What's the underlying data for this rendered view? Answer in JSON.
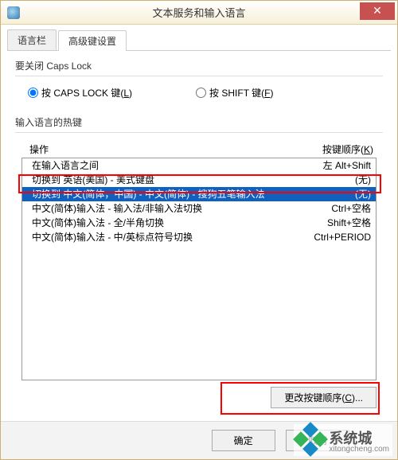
{
  "window": {
    "title": "文本服务和输入语言"
  },
  "tabs": {
    "tab1": "语言栏",
    "tab2": "高级键设置"
  },
  "group1": {
    "label": "要关闭 Caps Lock",
    "radio1_pre": "按 CAPS LOCK 键(",
    "radio1_u": "L",
    "radio1_post": ")",
    "radio2_pre": "按 SHIFT 键(",
    "radio2_u": "F",
    "radio2_post": ")"
  },
  "group2": {
    "label": "输入语言的热键",
    "col1": "操作",
    "col2_pre": "按键顺序(",
    "col2_u": "K",
    "col2_post": ")"
  },
  "rows": [
    {
      "op": "在输入语言之间",
      "key": "左 Alt+Shift"
    },
    {
      "op": "切换到 英语(美国) - 美式键盘",
      "key": "(无)"
    },
    {
      "op": "切换到 中文(简体，中国) - 中文(简体) - 搜狗五笔输入法",
      "key": "(无)"
    },
    {
      "op": "中文(简体)输入法 - 输入法/非输入法切换",
      "key": "Ctrl+空格"
    },
    {
      "op": "中文(简体)输入法 - 全/半角切换",
      "key": "Shift+空格"
    },
    {
      "op": "中文(简体)输入法 - 中/英标点符号切换",
      "key": "Ctrl+PERIOD"
    }
  ],
  "buttons": {
    "change_pre": "更改按键顺序(",
    "change_u": "C",
    "change_post": ")...",
    "ok": "确定",
    "cancel": "取消"
  },
  "watermark": {
    "text": "系统城",
    "sub": "xitongcheng.com"
  }
}
